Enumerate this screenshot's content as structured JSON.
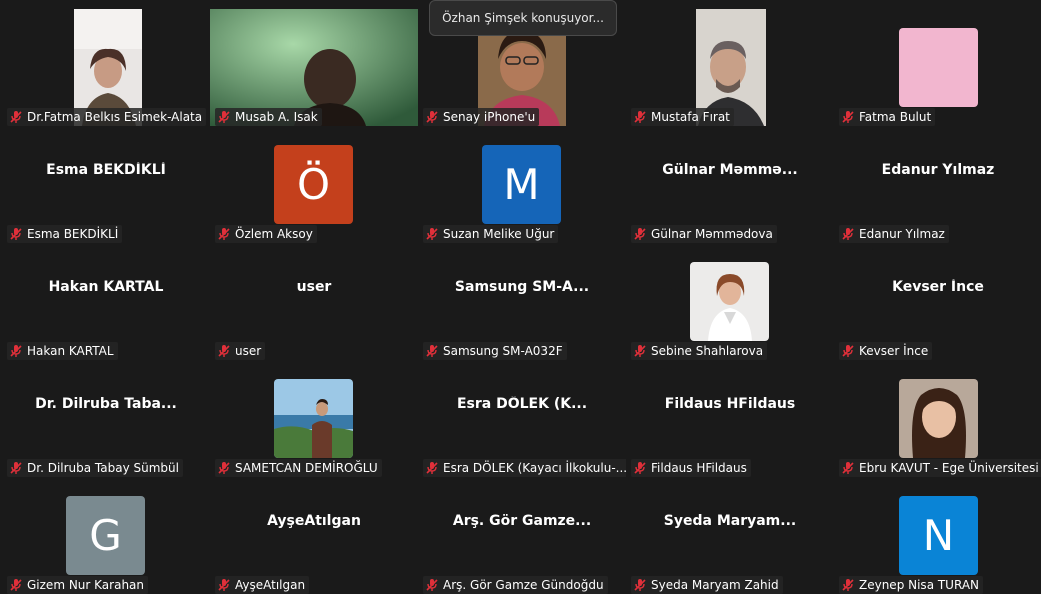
{
  "speaking_toast": "Özhan Şimşek konuşuyor...",
  "participants": [
    {
      "label": "Dr.Fatma Belkıs Esimek-Alata",
      "big_name": "",
      "avatar_letter": "",
      "type": "video"
    },
    {
      "label": "Musab A. Isak",
      "big_name": "",
      "avatar_letter": "",
      "type": "video"
    },
    {
      "label": "Senay iPhone'u",
      "big_name": "",
      "avatar_letter": "",
      "type": "video"
    },
    {
      "label": "Mustafa Fırat",
      "big_name": "",
      "avatar_letter": "",
      "type": "video"
    },
    {
      "label": "Fatma Bulut",
      "big_name": "",
      "avatar_letter": "",
      "type": "pink-avatar"
    },
    {
      "label": "Esma BEKDİKLİ",
      "big_name": "Esma BEKDİKLİ",
      "avatar_letter": "",
      "type": "name"
    },
    {
      "label": "Özlem Aksoy",
      "big_name": "",
      "avatar_letter": "Ö",
      "type": "letter"
    },
    {
      "label": "Suzan Melike Uğur",
      "big_name": "",
      "avatar_letter": "M",
      "type": "letter"
    },
    {
      "label": "Gülnar Məmmədova",
      "big_name": "Gülnar  Məmmə...",
      "avatar_letter": "",
      "type": "name"
    },
    {
      "label": "Edanur Yılmaz",
      "big_name": "Edanur Yılmaz",
      "avatar_letter": "",
      "type": "name"
    },
    {
      "label": "Hakan KARTAL",
      "big_name": "Hakan KARTAL",
      "avatar_letter": "",
      "type": "name"
    },
    {
      "label": "user",
      "big_name": "user",
      "avatar_letter": "",
      "type": "name"
    },
    {
      "label": "Samsung SM-A032F",
      "big_name": "Samsung  SM-A...",
      "avatar_letter": "",
      "type": "name"
    },
    {
      "label": "Sebine Shahlarova",
      "big_name": "",
      "avatar_letter": "",
      "type": "photo"
    },
    {
      "label": "Kevser İnce",
      "big_name": "Kevser İnce",
      "avatar_letter": "",
      "type": "name"
    },
    {
      "label": "Dr. Dilruba Tabay Sümbül",
      "big_name": "Dr.  Dilruba  Taba...",
      "avatar_letter": "",
      "type": "name"
    },
    {
      "label": "SAMETCAN DEMİROĞLU",
      "big_name": "",
      "avatar_letter": "",
      "type": "photo"
    },
    {
      "label": "Esra DÖLEK    (Kayacı İlkokulu-...",
      "big_name": "Esra DÖLEK    (K...",
      "avatar_letter": "",
      "type": "name"
    },
    {
      "label": "Fildaus HFildaus",
      "big_name": "Fildaus HFildaus",
      "avatar_letter": "",
      "type": "name"
    },
    {
      "label": "Ebru KAVUT - Ege Üniversitesi",
      "big_name": "",
      "avatar_letter": "",
      "type": "photo"
    },
    {
      "label": "Gizem Nur Karahan",
      "big_name": "",
      "avatar_letter": "G",
      "type": "letter"
    },
    {
      "label": "AyşeAtılgan",
      "big_name": "AyşeAtılgan",
      "avatar_letter": "",
      "type": "name"
    },
    {
      "label": "Arş. Gör Gamze Gündoğdu",
      "big_name": "Arş.  Gör  Gamze...",
      "avatar_letter": "",
      "type": "name"
    },
    {
      "label": "Syeda Maryam Zahid",
      "big_name": "Syeda  Maryam...",
      "avatar_letter": "",
      "type": "name"
    },
    {
      "label": "Zeynep Nisa TURAN",
      "big_name": "",
      "avatar_letter": "N",
      "type": "letter"
    }
  ],
  "colors": {
    "background": "#1a1a1a",
    "avatar_orange": "#c4401c",
    "avatar_blue": "#1565b8",
    "avatar_gray": "#7a8a90",
    "avatar_lightblue": "#0a84d6",
    "avatar_pink": "#f2b6cf",
    "muted_mic": "#e0303a"
  }
}
